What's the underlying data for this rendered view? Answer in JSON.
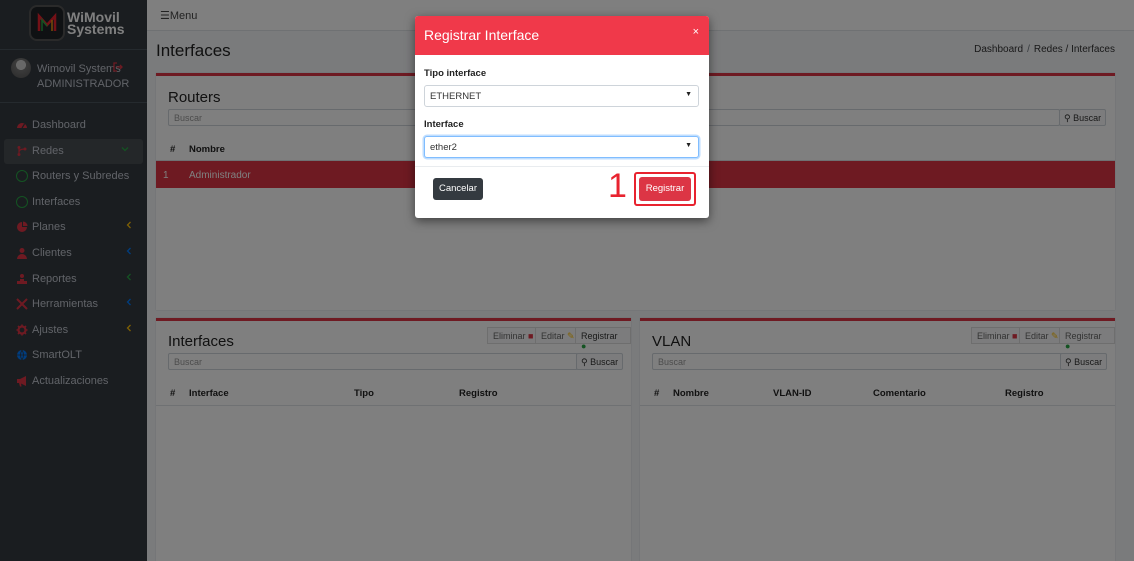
{
  "brand": {
    "line1": "WiMovil",
    "line2": "Systems"
  },
  "user": {
    "name": "Wimovil Systems",
    "role": "ADMINISTRADOR"
  },
  "sidebar": {
    "items": [
      {
        "label": "Dashboard",
        "icon": "dashboard-icon",
        "color": "#dc3545"
      },
      {
        "label": "Redes",
        "icon": "network-icon",
        "color": "#dc3545",
        "active": true
      },
      {
        "label": "Routers y Subredes",
        "icon": "circle-icon",
        "color": "#28a745"
      },
      {
        "label": "Interfaces",
        "icon": "circle-icon",
        "color": "#28a745"
      },
      {
        "label": "Planes",
        "icon": "pie-chart-icon",
        "color": "#dc3545"
      },
      {
        "label": "Clientes",
        "icon": "user-icon",
        "color": "#dc3545"
      },
      {
        "label": "Reportes",
        "icon": "report-icon",
        "color": "#dc3545"
      },
      {
        "label": "Herramientas",
        "icon": "tools-icon",
        "color": "#dc3545"
      },
      {
        "label": "Ajustes",
        "icon": "gear-icon",
        "color": "#dc3545"
      },
      {
        "label": "SmartOLT",
        "icon": "globe-icon",
        "color": "#007bff"
      },
      {
        "label": "Actualizaciones",
        "icon": "megaphone-icon",
        "color": "#dc3545"
      }
    ]
  },
  "topbar": {
    "menu_label": "Menu"
  },
  "page": {
    "title": "Interfaces"
  },
  "breadcrumb": {
    "home": "Dashboard",
    "current": "Redes / Interfaces"
  },
  "routers_card": {
    "title": "Routers",
    "search_placeholder": "Buscar",
    "search_button": "Buscar",
    "columns": [
      "#",
      "Nombre"
    ],
    "rows": [
      {
        "num": "1",
        "name": "Administrador"
      }
    ]
  },
  "interfaces_card": {
    "title": "Interfaces",
    "btn_delete": "Eliminar",
    "btn_edit": "Editar",
    "btn_register": "Registrar",
    "search_placeholder": "Buscar",
    "search_button": "Buscar",
    "columns": [
      "#",
      "Interface",
      "Tipo",
      "Registro"
    ]
  },
  "vlan_card": {
    "title": "VLAN",
    "btn_delete": "Eliminar",
    "btn_edit": "Editar",
    "btn_register": "Registrar",
    "search_placeholder": "Buscar",
    "search_button": "Buscar",
    "columns": [
      "#",
      "Nombre",
      "VLAN-ID",
      "Comentario",
      "Registro"
    ]
  },
  "modal": {
    "title": "Registrar Interface",
    "close": "×",
    "type_label": "Tipo interface",
    "type_value": "ETHERNET",
    "interface_label": "Interface",
    "interface_value": "ether2",
    "cancel_label": "Cancelar",
    "register_label": "Registrar"
  },
  "annotation": {
    "step": "1"
  },
  "colors": {
    "accent": "#dc3545",
    "modal_header": "#f0394a",
    "sidebar_bg": "#343a40",
    "highlight": "#e8232f"
  }
}
